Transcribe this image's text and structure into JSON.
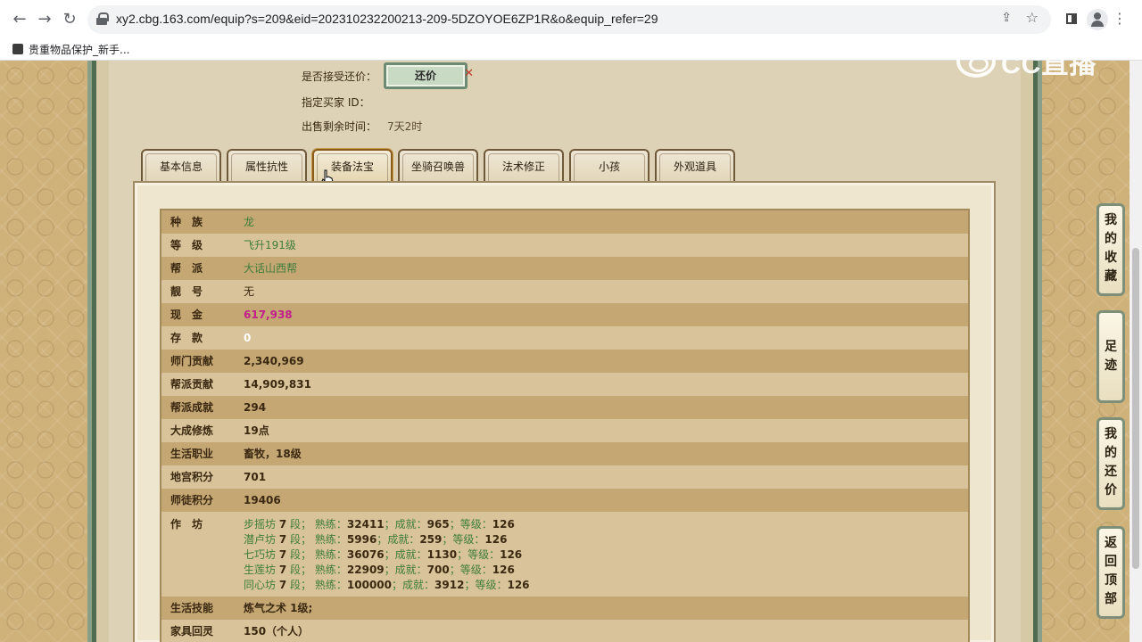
{
  "browser": {
    "url": "xy2.cbg.163.com/equip?s=209&eid=202310232200213-209-5DZOYOE6ZP1R&o&equip_refer=29",
    "bookmark": "贵重物品保护_新手..."
  },
  "watermark": "CC直播",
  "top_fields": {
    "accept_counter_label": "是否接受还价：",
    "counter_button": "还价",
    "buyer_id_label": "指定买家 ID：",
    "remaining_label": "出售剩余时间：",
    "remaining_value": "7天2时"
  },
  "tabs": [
    "基本信息",
    "属性抗性",
    "装备法宝",
    "坐骑召唤兽",
    "法术修正",
    "小孩",
    "外观道具"
  ],
  "active_tab": "装备法宝",
  "rows": [
    {
      "k": "种　族",
      "v": "龙"
    },
    {
      "k": "等　级",
      "v": "飞升191级"
    },
    {
      "k": "帮　派",
      "v": "大话山西帮"
    },
    {
      "k": "靓　号",
      "v": "无"
    },
    {
      "k": "现　金",
      "v": "617,938"
    },
    {
      "k": "存　款",
      "v": "0"
    },
    {
      "k": "师门贡献",
      "v": "2,340,969"
    },
    {
      "k": "帮派贡献",
      "v": "14,909,831"
    },
    {
      "k": "帮派成就",
      "v": "294"
    },
    {
      "k": "大成修炼",
      "v": "19点"
    },
    {
      "k": "生活职业",
      "v": "畜牧，18级"
    },
    {
      "k": "地宫积分",
      "v": "701"
    },
    {
      "k": "师徒积分",
      "v": "19406"
    }
  ],
  "workshop": {
    "k": "作　坊",
    "lines": [
      {
        "name": "步摇坊",
        "level": "7",
        "skill": "32411",
        "achieve": "965",
        "grade": "126"
      },
      {
        "name": "潜卢坊",
        "level": "7",
        "skill": "5996",
        "achieve": "259",
        "grade": "126"
      },
      {
        "name": "七巧坊",
        "level": "7",
        "skill": "36076",
        "achieve": "1130",
        "grade": "126"
      },
      {
        "name": "生莲坊",
        "level": "7",
        "skill": "22909",
        "achieve": "700",
        "grade": "126"
      },
      {
        "name": "同心坊",
        "level": "7",
        "skill": "100000",
        "achieve": "3912",
        "grade": "126"
      }
    ],
    "labels": {
      "duan": "段；",
      "skill": "熟练：",
      "achieve": "成就：",
      "grade": "等级："
    }
  },
  "rows_after": [
    {
      "k": "生活技能",
      "v": "炼气之术 1级;"
    },
    {
      "k": "家具回灵",
      "v": "150（个人）"
    }
  ],
  "side_menu": [
    {
      "chars": [
        "我",
        "的",
        "收",
        "藏"
      ]
    },
    {
      "chars": [
        "足",
        "迹"
      ]
    },
    {
      "chars": [
        "我",
        "的",
        "还",
        "价"
      ]
    },
    {
      "chars": [
        "返",
        "回",
        "顶",
        "部"
      ]
    }
  ]
}
